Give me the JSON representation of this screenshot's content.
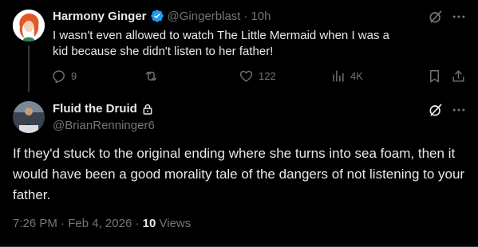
{
  "parent_tweet": {
    "display_name": "Harmony Ginger",
    "handle": "@Gingerblast",
    "separator": "·",
    "time_ago": "10h",
    "text": "I wasn't even allowed to watch The Little Mermaid when I was a kid because she didn't listen to her father!",
    "replies": "9",
    "likes": "122",
    "views": "4K",
    "verified_badge_color": "#1d9bf0"
  },
  "main_tweet": {
    "display_name": "Fluid the Druid",
    "handle": "@BrianRenninger6",
    "protected_icon": "lock-icon",
    "text": "If they'd stuck to the original ending where she turns into sea foam, then it would have been a good morality tale of the dangers of not listening to your father.",
    "time": "7:26 PM",
    "date": "Feb 4, 2026",
    "separator": "·",
    "views_count": "10",
    "views_label": "Views"
  },
  "icons": {
    "grok": "grok-icon",
    "more": "more-icon",
    "reply": "reply-icon",
    "retweet": "retweet-icon",
    "like": "heart-icon",
    "views": "analytics-icon",
    "bookmark": "bookmark-icon",
    "share": "share-icon"
  },
  "colors": {
    "background": "#000000",
    "text": "#e7e9ea",
    "muted": "#71767b",
    "verified": "#1d9bf0"
  }
}
